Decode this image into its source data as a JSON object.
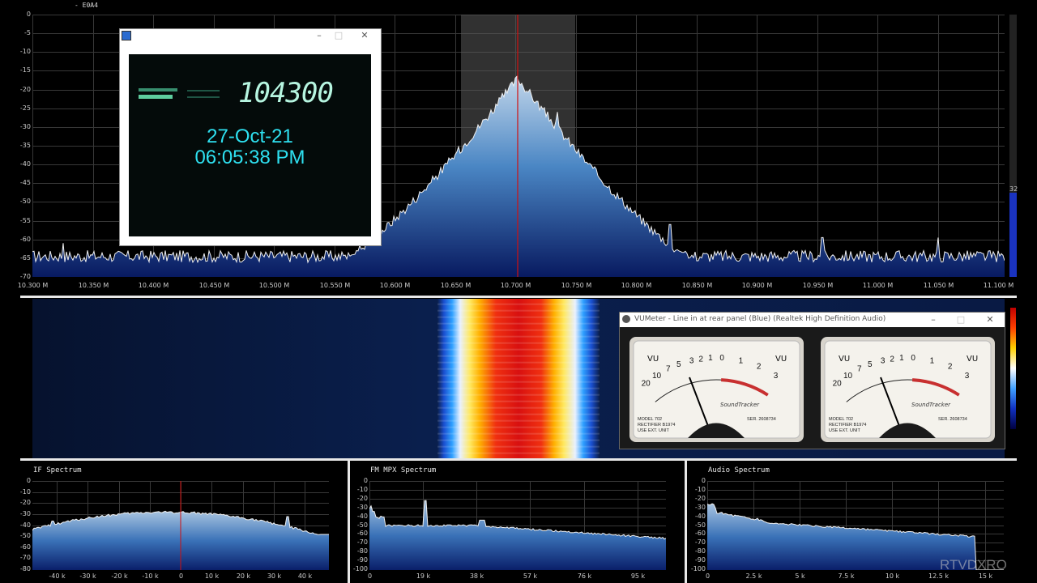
{
  "app": {
    "corner_label": "- E0A4",
    "watermark": "RTVDXRO"
  },
  "main_spectrum": {
    "db_ticks": [
      "0",
      "-5",
      "-10",
      "-15",
      "-20",
      "-25",
      "-30",
      "-35",
      "-40",
      "-45",
      "-50",
      "-55",
      "-60",
      "-65",
      "-70"
    ],
    "freq_ticks": [
      "10.300 M",
      "10.350 M",
      "10.400 M",
      "10.450 M",
      "10.500 M",
      "10.550 M",
      "10.600 M",
      "10.650 M",
      "10.700 M",
      "10.750 M",
      "10.800 M",
      "10.850 M",
      "10.900 M",
      "10.950 M",
      "11.000 M",
      "11.050 M",
      "11.100 M"
    ],
    "level_value": "32"
  },
  "video_window": {
    "icon": "video-icon",
    "frequency_display": "104300",
    "date": "27-Oct-21",
    "time": "06:05:38 PM"
  },
  "vumeter_window": {
    "title": "VUMeter - Line in at rear panel (Blue) (Realtek High Definition Audio)",
    "scale_labels": [
      "20",
      "10",
      "7",
      "5",
      "3",
      "2",
      "1",
      "0",
      "1",
      "2",
      "3"
    ],
    "model_text": "MODEL",
    "model_number": "702",
    "rectifier_text": "RECTIFIER",
    "rectifier_value": "B1974",
    "ext_text": "USE EXT. UNIT",
    "ser_text": "SER.",
    "ser_value": "2608734",
    "vu_label": "VU",
    "brand": "SoundTracker"
  },
  "if_spectrum": {
    "title": "IF Spectrum",
    "db_ticks": [
      "0",
      "-10",
      "-20",
      "-30",
      "-40",
      "-50",
      "-60",
      "-70",
      "-80"
    ],
    "freq_ticks": [
      "-40 k",
      "-30 k",
      "-20 k",
      "-10 k",
      "0",
      "10 k",
      "20 k",
      "30 k",
      "40 k"
    ]
  },
  "mpx_spectrum": {
    "title": "FM MPX Spectrum",
    "db_ticks": [
      "0",
      "-10",
      "-20",
      "-30",
      "-40",
      "-50",
      "-60",
      "-70",
      "-80",
      "-90",
      "-100"
    ],
    "freq_ticks": [
      "0",
      "19 k",
      "38 k",
      "57 k",
      "76 k",
      "95 k"
    ]
  },
  "audio_spectrum": {
    "title": "Audio Spectrum",
    "db_ticks": [
      "0",
      "-10",
      "-20",
      "-30",
      "-40",
      "-50",
      "-60",
      "-70",
      "-80",
      "-90",
      "-100"
    ],
    "freq_ticks": [
      "0",
      "2.5 k",
      "5 k",
      "7.5 k",
      "10 k",
      "12.5 k",
      "15 k"
    ]
  },
  "colors": {
    "grid": "#3a3a3a",
    "tuned_line": "#d01010",
    "spectrum_top": "#a8c4e0",
    "spectrum_bottom": "#0a1f6a"
  }
}
